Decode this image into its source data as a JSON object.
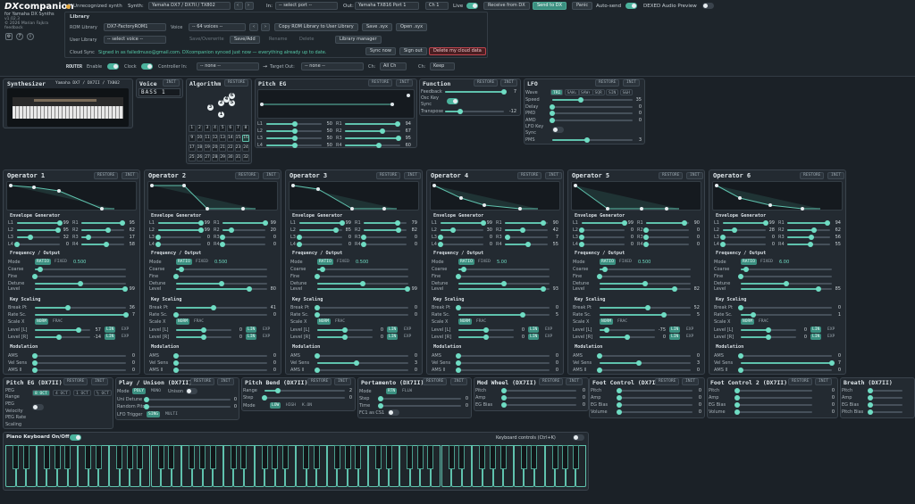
{
  "app": {
    "title_dx": "DX",
    "title_rest": "companion",
    "subtitle": "for Yamaha DX Synths",
    "version": "v1.02.3",
    "copyright": "© 2026 Marian Fajkra",
    "feedback": "feedback"
  },
  "topbar": {
    "status": "Unrecognized synth",
    "synth_label": "Synth:",
    "synth_value": "Yamaha DX7 / DX7II / TX802",
    "in_label": "In:",
    "in_value": "-- select port --",
    "out_label": "Out:",
    "out_value": "Yamaha TX816 Port 1",
    "ch_value": "Ch 1",
    "live_label": "Live",
    "receive": "Receive from DX",
    "send": "Send to DX",
    "panic": "Panic",
    "autosend": "Auto-send",
    "dexed": "DEXED Audio Preview"
  },
  "library": {
    "title": "Library",
    "rom_label": "ROM Library",
    "rom_value": "DX7-FactoryROM1",
    "voice_label": "Voice",
    "voice_value": "-- 64 voices --",
    "copy": "Copy ROM Library to User Library",
    "save_syx": "Save .syx",
    "open_syx": "Open .syx",
    "user_label": "User Library",
    "user_value": "-- select voice --",
    "save_over": "Save/Overwrite",
    "save_add": "Save/Add",
    "rename": "Rename",
    "delete": "Delete",
    "manager": "Library manager",
    "cloud_label": "Cloud Sync",
    "cloud_text": "Signed in as failedmuso@gmail.com. DXcompanion synced just now — everything already up to date.",
    "sync_now": "Sync now",
    "sign_out": "Sign out",
    "delete_cloud": "Delete my cloud data"
  },
  "router": {
    "label": "ROUTER",
    "enable": "Enable",
    "clock": "Clock",
    "controller_in": "Controller In:",
    "ctrl_value": "-- none --",
    "target_out": "Target Out:",
    "target_value": "-- none --",
    "ch_label": "Ch:",
    "ch_value": "All Ch",
    "ch2_label": "Ch:",
    "ch2_value": "Keep"
  },
  "synth": {
    "title": "Synthesizer",
    "model": "Yamaha DX7 / DX7II / TX802"
  },
  "voice": {
    "title": "Voice",
    "init": "INIT",
    "name": "BASS 1"
  },
  "algorithm": {
    "title": "Algorithm",
    "restore": "RESTORE",
    "numbers": [
      "1",
      "2",
      "3",
      "4",
      "5",
      "6",
      "7",
      "8",
      "9",
      "10",
      "11",
      "12",
      "13",
      "14",
      "15",
      "16",
      "17",
      "18",
      "19",
      "20",
      "21",
      "22",
      "23",
      "24",
      "25",
      "26",
      "27",
      "28",
      "29",
      "30",
      "31",
      "32"
    ],
    "selected": "16",
    "ops": [
      "6",
      "4",
      "5",
      "2",
      "3",
      "1"
    ]
  },
  "pitch_eg": {
    "title": "Pitch EG",
    "restore": "RESTORE",
    "init": "INIT",
    "rows": [
      {
        "l": "L1",
        "lv": "50",
        "r": "R1",
        "rv": "94"
      },
      {
        "l": "L2",
        "lv": "50",
        "r": "R2",
        "rv": "67"
      },
      {
        "l": "L3",
        "lv": "50",
        "r": "R3",
        "rv": "95"
      },
      {
        "l": "L4",
        "lv": "50",
        "r": "R4",
        "rv": "60"
      }
    ]
  },
  "function": {
    "title": "Function",
    "restore": "RESTORE",
    "init": "INIT",
    "feedback": "Feedback",
    "feedback_v": "7",
    "osc_key": "Osc Key",
    "sync": "Sync",
    "transpose": "Transpose",
    "transpose_v": "-12"
  },
  "lfo": {
    "title": "LFO",
    "restore": "RESTORE",
    "init": "INIT",
    "wave": "Wave",
    "waves": [
      "TRI",
      "SAW↓",
      "SAW↑",
      "SQR",
      "SIN",
      "S&H"
    ],
    "rows": [
      {
        "n": "Speed",
        "v": "35"
      },
      {
        "n": "Delay",
        "v": "0"
      },
      {
        "n": "PMD",
        "v": "0"
      },
      {
        "n": "AMD",
        "v": "0"
      }
    ],
    "keysync": "LFO Key",
    "sync": "Sync",
    "pms": "PMS",
    "pms_v": "3"
  },
  "operators": [
    {
      "title": "Operator 1",
      "l": [
        "99",
        "95",
        "32",
        "0"
      ],
      "r": [
        "95",
        "62",
        "17",
        "58"
      ],
      "mode": "RATIO",
      "fixed": "FIXED",
      "freq": "0.500",
      "level": "99",
      "bp": "36",
      "rs": "7",
      "ll": "57",
      "lr": "-14",
      "vs": "0"
    },
    {
      "title": "Operator 2",
      "l": [
        "99",
        "99",
        "0",
        "0"
      ],
      "r": [
        "99",
        "20",
        "0",
        "0"
      ],
      "mode": "RATIO",
      "fixed": "FIXED",
      "freq": "0.500",
      "level": "80",
      "bp": "41",
      "rs": "0",
      "ll": "0",
      "lr": "0",
      "vs": "0"
    },
    {
      "title": "Operator 3",
      "l": [
        "99",
        "85",
        "0",
        "0"
      ],
      "r": [
        "79",
        "82",
        "0",
        "0"
      ],
      "mode": "RATIO",
      "fixed": "FIXED",
      "freq": "0.500",
      "level": "99",
      "bp": "0",
      "rs": "0",
      "ll": "0",
      "lr": "0",
      "vs": "3"
    },
    {
      "title": "Operator 4",
      "l": [
        "99",
        "30",
        "0",
        "0"
      ],
      "r": [
        "90",
        "42",
        "7",
        "55"
      ],
      "mode": "RATIO",
      "fixed": "FIXED",
      "freq": "5.00",
      "level": "93",
      "bp": "0",
      "rs": "5",
      "ll": "0",
      "lr": "0",
      "vs": "0"
    },
    {
      "title": "Operator 5",
      "l": [
        "99",
        "0",
        "0",
        "0"
      ],
      "r": [
        "90",
        "0",
        "0",
        "0"
      ],
      "mode": "RATIO",
      "fixed": "FIXED",
      "freq": "0.500",
      "level": "82",
      "bp": "52",
      "rs": "5",
      "ll": "-75",
      "lr": "0",
      "vs": "3"
    },
    {
      "title": "Operator 6",
      "l": [
        "99",
        "28",
        "0",
        "0"
      ],
      "r": [
        "94",
        "62",
        "56",
        "55"
      ],
      "mode": "RATIO",
      "fixed": "FIXED",
      "freq": "6.00",
      "level": "85",
      "bp": "0",
      "rs": "1",
      "ll": "0",
      "lr": "0",
      "vs": "7"
    }
  ],
  "op_labels": {
    "restore": "RESTORE",
    "init": "INIT",
    "env": "Envelope Generator",
    "freq": "Frequency / Output",
    "mode": "Mode",
    "coarse": "Coarse",
    "fine": "Fine",
    "detune": "Detune",
    "level": "Level",
    "ks": "Key Scaling",
    "bp": "Break Pt",
    "rs": "Rate Sc.",
    "sx": "Scale X",
    "norm": "NORM",
    "frac": "FRAC",
    "ll": "Level [L]",
    "lr": "Level [R]",
    "lin": "LIN",
    "exp": "EXP",
    "mod": "Modulation",
    "ams": "AMS",
    "vs": "Vel Sens",
    "ams2": "AMS II",
    "zero": "0"
  },
  "bottom": {
    "peg": {
      "title": "Pitch EG (DX7II)",
      "restore": "RESTORE",
      "init": "INIT",
      "peg": "PEG",
      "range": "Range",
      "octs": [
        "8 OCT",
        "4 OCT",
        "1 OCT",
        "½ OCT"
      ],
      "peg2": "PEG",
      "vel": "Velocity",
      "rate": "PEG Rate",
      "scaling": "Scaling"
    },
    "play": {
      "title": "Play / Unison (DX7II)",
      "restore": "RESTORE",
      "init": "INIT",
      "mode": "Mode",
      "poly": "POLY",
      "mono": "MONO",
      "unison": "Unison",
      "detune": "Uni Detune",
      "detune_v": "0",
      "random": "Random Pitch",
      "random_v": "0",
      "trigger": "LFO Trigger",
      "sing": "SING",
      "multi": "MULTI"
    },
    "bend": {
      "title": "Pitch Bend (DX7II)",
      "restore": "RESTORE",
      "init": "INIT",
      "range": "Range",
      "range_v": "2",
      "step": "Step",
      "step_v": "0",
      "mode": "Mode",
      "low": "LOW",
      "high": "HIGH",
      "kon": "K.ON"
    },
    "porta": {
      "title": "Portamento (DX7II)",
      "restore": "RESTORE",
      "init": "INIT",
      "mode": "Mode",
      "rtn": "RTN",
      "fllw": "FLLW",
      "step": "Step",
      "step_v": "0",
      "time": "Time",
      "time_v": "0",
      "fc1": "FC1 as CS1"
    },
    "modwheel": {
      "title": "Mod Wheel (DX7II)",
      "restore": "RESTORE",
      "init": "INIT",
      "rows": [
        "Pitch",
        "Amp",
        "EG Bias"
      ],
      "vals": [
        "0",
        "0",
        "0"
      ]
    },
    "foot1": {
      "title": "Foot Control (DX7II)",
      "restore": "RESTORE",
      "init": "INIT",
      "rows": [
        "Pitch",
        "Amp",
        "EG Bias",
        "Volume"
      ],
      "vals": [
        "0",
        "0",
        "0",
        "0"
      ]
    },
    "foot2": {
      "title": "Foot Control 2 (DX7II)",
      "restore": "RESTORE",
      "init": "INIT",
      "rows": [
        "Pitch",
        "Amp",
        "EG Bias",
        "Volume"
      ],
      "vals": [
        "0",
        "0",
        "0",
        "0"
      ]
    },
    "breath": {
      "title": "Breath (DX7II)",
      "rows": [
        "Pitch",
        "Amp",
        "EG Bias",
        "Pitch Bias"
      ]
    }
  },
  "keyboard": {
    "title": "Piano Keyboard On/Off",
    "controls": "Keyboard controls (Ctrl+K)"
  }
}
